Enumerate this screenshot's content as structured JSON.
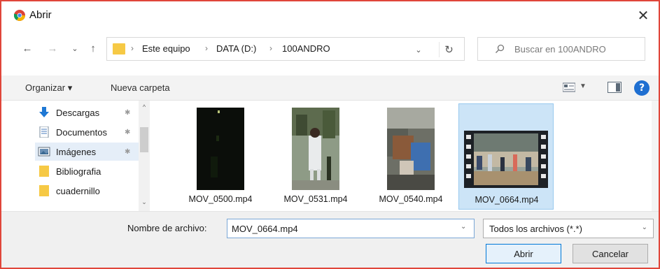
{
  "window": {
    "title": "Abrir",
    "close_glyph": "✕"
  },
  "nav": {
    "back_glyph": "←",
    "forward_glyph": "→",
    "recent_glyph": "⌄",
    "up_glyph": "↑",
    "breadcrumbs": [
      "Este equipo",
      "DATA (D:)",
      "100ANDRO"
    ],
    "crumb_sep": "›",
    "refresh_glyph": "↻",
    "dropdown_glyph": "⌄",
    "search_placeholder": "Buscar en 100ANDRO"
  },
  "toolbar": {
    "organize_label": "Organizar ▾",
    "new_folder_label": "Nueva carpeta",
    "view_dropdown_glyph": "▼",
    "help_glyph": "?"
  },
  "sidebar": {
    "items": [
      {
        "label": "Descargas",
        "icon": "download-icon",
        "pinned": true
      },
      {
        "label": "Documentos",
        "icon": "documents-icon",
        "pinned": true
      },
      {
        "label": "Imágenes",
        "icon": "pictures-icon",
        "pinned": true
      },
      {
        "label": "Bibliografia",
        "icon": "folder-icon",
        "pinned": false
      },
      {
        "label": "cuadernillo",
        "icon": "folder-icon",
        "pinned": false
      }
    ],
    "pin_glyph": "✱",
    "scroll_up_glyph": "^",
    "scroll_down_glyph": "⌄"
  },
  "files": [
    {
      "name": "MOV_0500.mp4",
      "selected": false
    },
    {
      "name": "MOV_0531.mp4",
      "selected": false
    },
    {
      "name": "MOV_0540.mp4",
      "selected": false
    },
    {
      "name": "MOV_0664.mp4",
      "selected": true
    }
  ],
  "footer": {
    "filename_label": "Nombre de archivo:",
    "filename_value": "MOV_0664.mp4",
    "filetype_value": "Todos los archivos (*.*)",
    "dropdown_glyph": "⌄",
    "open_label": "Abrir",
    "cancel_label": "Cancelar"
  },
  "colors": {
    "window_border": "#e0463a",
    "selection_bg": "#cce4f7",
    "selection_border": "#99c9ef",
    "accent": "#0078d7",
    "folder": "#f6c945"
  }
}
